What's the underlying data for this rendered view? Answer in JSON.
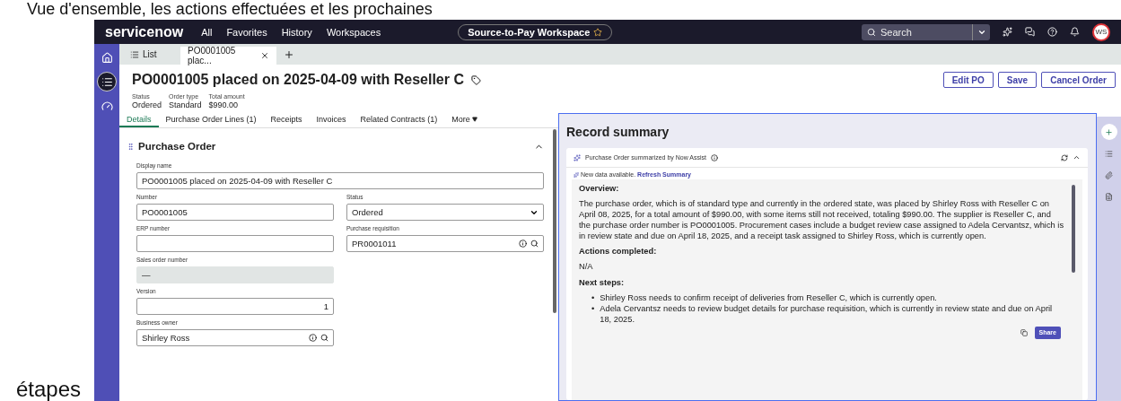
{
  "caption_top": "Vue d'ensemble, les actions effectuées et les prochaines",
  "caption_bottom": "étapes",
  "navbar": {
    "logo": "servicenow",
    "menu": [
      "All",
      "Favorites",
      "History",
      "Workspaces"
    ],
    "workspace": "Source-to-Pay Workspace",
    "search": {
      "placeholder": "Search"
    },
    "avatar": "WS"
  },
  "rail": [
    {
      "kind": "home",
      "selected": false
    },
    {
      "kind": "list",
      "selected": true
    },
    {
      "kind": "chart",
      "selected": false
    }
  ],
  "page_tabs": [
    {
      "kind": "list",
      "label": "List",
      "selected": false
    },
    {
      "kind": "record",
      "label": "PO0001005 plac...",
      "selected": true
    }
  ],
  "record": {
    "title": "PO0001005 placed on 2025-04-09 with Reseller C",
    "meta": [
      {
        "label": "Status",
        "value": "Ordered"
      },
      {
        "label": "Order type",
        "value": "Standard"
      },
      {
        "label": "Total amount",
        "value": "$990.00"
      }
    ],
    "actions": [
      "Edit PO",
      "Save",
      "Cancel Order"
    ]
  },
  "tabs": [
    {
      "kind": "tab",
      "label": "Details",
      "selected": true
    },
    {
      "kind": "tab",
      "label": "Purchase Order Lines (1)",
      "selected": false
    },
    {
      "kind": "tab",
      "label": "Receipts",
      "selected": false
    },
    {
      "kind": "tab",
      "label": "Invoices",
      "selected": false
    },
    {
      "kind": "tab",
      "label": "Related Contracts (1)",
      "selected": false
    },
    {
      "kind": "menu",
      "label": "More",
      "selected": false
    }
  ],
  "form": {
    "section": "Purchase Order",
    "expanded": true,
    "display_name": {
      "label": "Display name",
      "value": "PO0001005 placed on 2025-04-09 with Reseller C",
      "kind": "text"
    },
    "left": [
      {
        "label": "Number",
        "value": "PO0001005",
        "kind": "text"
      },
      {
        "label": "ERP number",
        "kind": "text"
      },
      {
        "label": "Sales order number",
        "value": "—",
        "kind": "readonly"
      },
      {
        "label": "Version",
        "value": "1",
        "kind": "number"
      },
      {
        "label": "Business owner",
        "value": "Shirley Ross",
        "kind": "reference"
      }
    ],
    "right": [
      {
        "label": "Status",
        "value": "Ordered",
        "kind": "select"
      },
      {
        "label": "Purchase requisition",
        "value": "PR0001011",
        "kind": "reference"
      }
    ]
  },
  "summary": {
    "title": "Record summary",
    "card": {
      "title": "Purchase Order summarized by Now Assist",
      "expanded": true,
      "notice": "New data available.",
      "link": "Refresh Summary",
      "sections": [
        {
          "kind": "paragraph",
          "heading": "Overview:",
          "text": "The purchase order, which is of standard type and currently in the ordered state, was placed by Shirley Ross with Reseller C on April 08, 2025, for a total amount of $990.00, with some items still not received, totaling $990.00. The supplier is Reseller C, and the purchase order number is PO0001005. Procurement cases include a budget review case assigned to Adela Cervantsz, which is in review state and due on April 18, 2025, and a receipt task assigned to Shirley Ross, which is currently open."
        },
        {
          "kind": "paragraph",
          "heading": "Actions completed:",
          "text": "N/A"
        },
        {
          "kind": "bullets",
          "heading": "Next steps:",
          "items": [
            {
              "marker": "•",
              "text": "Shirley Ross needs to confirm receipt of deliveries from Reseller C, which is currently open."
            },
            {
              "marker": "•",
              "text": "Adela Cervantsz needs to review budget details for purchase requisition, which is currently in review state and due on April 18, 2025."
            }
          ]
        }
      ],
      "share": "Share"
    }
  },
  "side_tools": [
    {
      "kind": "assist",
      "selected": true
    },
    {
      "kind": "list",
      "selected": false
    },
    {
      "kind": "attachment",
      "selected": false
    },
    {
      "kind": "document",
      "selected": false
    }
  ]
}
